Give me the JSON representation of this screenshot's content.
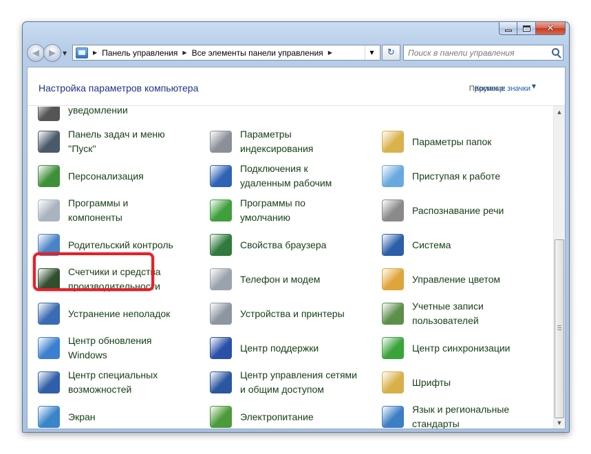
{
  "window": {
    "caption_buttons": {
      "minimize": "–",
      "maximize": "□",
      "close": "✕"
    }
  },
  "nav": {
    "back_glyph": "◀",
    "forward_glyph": "▶",
    "refresh_glyph": "↻",
    "breadcrumb": [
      "Панель управления",
      "Все элементы панели управления"
    ],
    "search_placeholder": "Поиск в панели управления"
  },
  "header": {
    "title": "Настройка параметров компьютера",
    "view_by_label": "Просмотр:",
    "view_by_value": "Крупные значки"
  },
  "items": [
    {
      "label": "уведомлении",
      "icon": "notification-icon",
      "color": "#555555"
    },
    {
      "label": "Панель задач и меню\n''Пуск''",
      "icon": "taskbar-icon",
      "color": "#4a5a6a"
    },
    {
      "label": "Параметры\nиндексирования",
      "icon": "indexing-icon",
      "color": "#8a8f98"
    },
    {
      "label": "Параметры папок",
      "icon": "folder-options-icon",
      "color": "#d9b24c"
    },
    {
      "label": "Персонализация",
      "icon": "personalization-icon",
      "color": "#3f8f3a"
    },
    {
      "label": "Подключения к\nудаленным рабочим",
      "icon": "remote-desktop-icon",
      "color": "#2f62b5"
    },
    {
      "label": "Приступая к работе",
      "icon": "getting-started-icon",
      "color": "#6aa9df"
    },
    {
      "label": "Программы и\nкомпоненты",
      "icon": "programs-features-icon",
      "color": "#a9b4bf"
    },
    {
      "label": "Программы по\nумолчанию",
      "icon": "default-programs-icon",
      "color": "#3e9f3b"
    },
    {
      "label": "Распознавание речи",
      "icon": "microphone-icon",
      "color": "#8a8a8a"
    },
    {
      "label": "Родительский контроль",
      "icon": "parental-controls-icon",
      "color": "#4b84c6"
    },
    {
      "label": "Свойства браузера",
      "icon": "internet-options-icon",
      "color": "#2f7a3c"
    },
    {
      "label": "Система",
      "icon": "system-icon",
      "color": "#2d5fa8"
    },
    {
      "label": "Счетчики и средства\nпроизводительности",
      "icon": "performance-icon",
      "color": "#2f4f2f"
    },
    {
      "label": "Телефон и модем",
      "icon": "phone-modem-icon",
      "color": "#9aa3ad"
    },
    {
      "label": "Управление цветом",
      "icon": "color-management-icon",
      "color": "#e0a53a"
    },
    {
      "label": "Устранение неполадок",
      "icon": "troubleshooting-icon",
      "color": "#3a6bb3"
    },
    {
      "label": "Устройства и принтеры",
      "icon": "devices-printers-icon",
      "color": "#8c96a1"
    },
    {
      "label": "Учетные записи\nпользователей",
      "icon": "user-accounts-icon",
      "color": "#5d8f4b"
    },
    {
      "label": "Центр обновления\nWindows",
      "icon": "windows-update-icon",
      "color": "#3c7fd0"
    },
    {
      "label": "Центр поддержки",
      "icon": "action-center-flag-icon",
      "color": "#2a4fa8"
    },
    {
      "label": "Центр синхронизации",
      "icon": "sync-center-icon",
      "color": "#3aa33a"
    },
    {
      "label": "Центр специальных\nвозможностей",
      "icon": "ease-of-access-icon",
      "color": "#2f5fa8"
    },
    {
      "label": "Центр управления сетями\nи общим доступом",
      "icon": "network-sharing-icon",
      "color": "#2b56a0"
    },
    {
      "label": "Шрифты",
      "icon": "fonts-icon",
      "color": "#d8b04a"
    },
    {
      "label": "Экран",
      "icon": "display-icon",
      "color": "#3a84c9"
    },
    {
      "label": "Электропитание",
      "icon": "power-options-icon",
      "color": "#4c9a3a"
    },
    {
      "label": "Язык и региональные\nстандарты",
      "icon": "region-language-icon",
      "color": "#3d7ec4"
    }
  ],
  "highlight_color": "#e4202a"
}
